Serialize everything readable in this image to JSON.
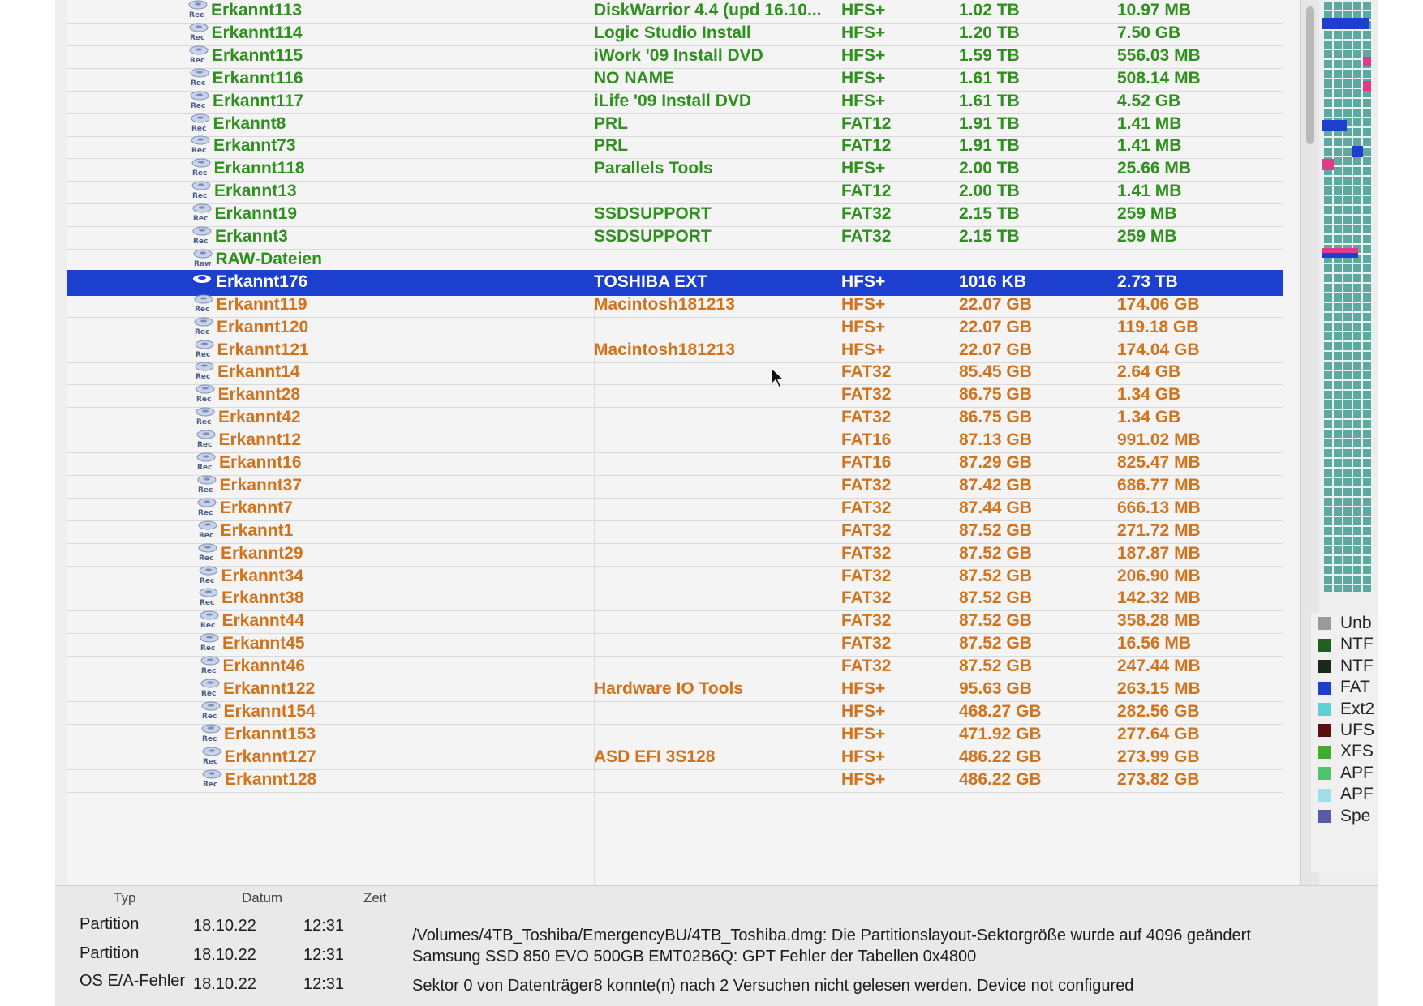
{
  "partitions": [
    {
      "name": "Erkannt113",
      "label": "DiskWarrior 4.4 (upd 16.10...",
      "fs": "HFS+",
      "start": "1.02 TB",
      "size": "10.97 MB",
      "group": "green",
      "icon": "rec-disk-icon"
    },
    {
      "name": "Erkannt114",
      "label": "Logic Studio Install",
      "fs": "HFS+",
      "start": "1.20 TB",
      "size": "7.50 GB",
      "group": "green",
      "icon": "rec-disk-icon"
    },
    {
      "name": "Erkannt115",
      "label": "iWork '09 Install DVD",
      "fs": "HFS+",
      "start": "1.59 TB",
      "size": "556.03 MB",
      "group": "green",
      "icon": "rec-disk-icon"
    },
    {
      "name": "Erkannt116",
      "label": "NO NAME",
      "fs": "HFS+",
      "start": "1.61 TB",
      "size": "508.14 MB",
      "group": "green",
      "icon": "rec-disk-icon"
    },
    {
      "name": "Erkannt117",
      "label": "iLife '09 Install DVD",
      "fs": "HFS+",
      "start": "1.61 TB",
      "size": "4.52 GB",
      "group": "green",
      "icon": "rec-disk-icon"
    },
    {
      "name": "Erkannt8",
      "label": "PRL",
      "fs": "FAT12",
      "start": "1.91 TB",
      "size": "1.41 MB",
      "group": "green",
      "icon": "rec-disk-icon"
    },
    {
      "name": "Erkannt73",
      "label": "PRL",
      "fs": "FAT12",
      "start": "1.91 TB",
      "size": "1.41 MB",
      "group": "green",
      "icon": "rec-disk-icon"
    },
    {
      "name": "Erkannt118",
      "label": "Parallels Tools",
      "fs": "HFS+",
      "start": "2.00 TB",
      "size": "25.66 MB",
      "group": "green",
      "icon": "rec-disk-icon"
    },
    {
      "name": "Erkannt13",
      "label": "",
      "fs": "FAT12",
      "start": "2.00 TB",
      "size": "1.41 MB",
      "group": "green",
      "icon": "rec-disk-icon"
    },
    {
      "name": "Erkannt19",
      "label": "SSDSUPPORT",
      "fs": "FAT32",
      "start": "2.15 TB",
      "size": "259 MB",
      "group": "green",
      "icon": "rec-disk-icon"
    },
    {
      "name": "Erkannt3",
      "label": "SSDSUPPORT",
      "fs": "FAT32",
      "start": "2.15 TB",
      "size": "259 MB",
      "group": "green",
      "icon": "rec-disk-icon"
    },
    {
      "name": "RAW-Dateien",
      "label": "",
      "fs": "",
      "start": "",
      "size": "",
      "group": "green",
      "icon": "raw-disk-icon"
    },
    {
      "name": "Erkannt176",
      "label": "TOSHIBA EXT",
      "fs": "HFS+",
      "start": "1016 KB",
      "size": "2.73 TB",
      "group": "selected",
      "icon": "disk-icon"
    },
    {
      "name": "Erkannt119",
      "label": "Macintosh181213",
      "fs": "HFS+",
      "start": "22.07 GB",
      "size": "174.06 GB",
      "group": "orange",
      "icon": "rec-disk-icon"
    },
    {
      "name": "Erkannt120",
      "label": "",
      "fs": "HFS+",
      "start": "22.07 GB",
      "size": "119.18 GB",
      "group": "orange",
      "icon": "rec-disk-icon"
    },
    {
      "name": "Erkannt121",
      "label": "Macintosh181213",
      "fs": "HFS+",
      "start": "22.07 GB",
      "size": "174.04 GB",
      "group": "orange",
      "icon": "rec-disk-icon"
    },
    {
      "name": "Erkannt14",
      "label": "",
      "fs": "FAT32",
      "start": "85.45 GB",
      "size": "2.64 GB",
      "group": "orange",
      "icon": "rec-disk-icon"
    },
    {
      "name": "Erkannt28",
      "label": "",
      "fs": "FAT32",
      "start": "86.75 GB",
      "size": "1.34 GB",
      "group": "orange",
      "icon": "rec-disk-icon"
    },
    {
      "name": "Erkannt42",
      "label": "",
      "fs": "FAT32",
      "start": "86.75 GB",
      "size": "1.34 GB",
      "group": "orange",
      "icon": "rec-disk-icon"
    },
    {
      "name": "Erkannt12",
      "label": "",
      "fs": "FAT16",
      "start": "87.13 GB",
      "size": "991.02 MB",
      "group": "orange",
      "icon": "rec-disk-icon"
    },
    {
      "name": "Erkannt16",
      "label": "",
      "fs": "FAT16",
      "start": "87.29 GB",
      "size": "825.47 MB",
      "group": "orange",
      "icon": "rec-disk-icon"
    },
    {
      "name": "Erkannt37",
      "label": "",
      "fs": "FAT32",
      "start": "87.42 GB",
      "size": "686.77 MB",
      "group": "orange",
      "icon": "rec-disk-icon"
    },
    {
      "name": "Erkannt7",
      "label": "",
      "fs": "FAT32",
      "start": "87.44 GB",
      "size": "666.13 MB",
      "group": "orange",
      "icon": "rec-disk-icon"
    },
    {
      "name": "Erkannt1",
      "label": "",
      "fs": "FAT32",
      "start": "87.52 GB",
      "size": "271.72 MB",
      "group": "orange",
      "icon": "rec-disk-icon"
    },
    {
      "name": "Erkannt29",
      "label": "",
      "fs": "FAT32",
      "start": "87.52 GB",
      "size": "187.87 MB",
      "group": "orange",
      "icon": "rec-disk-icon"
    },
    {
      "name": "Erkannt34",
      "label": "",
      "fs": "FAT32",
      "start": "87.52 GB",
      "size": "206.90 MB",
      "group": "orange",
      "icon": "rec-disk-icon"
    },
    {
      "name": "Erkannt38",
      "label": "",
      "fs": "FAT32",
      "start": "87.52 GB",
      "size": "142.32 MB",
      "group": "orange",
      "icon": "rec-disk-icon"
    },
    {
      "name": "Erkannt44",
      "label": "",
      "fs": "FAT32",
      "start": "87.52 GB",
      "size": "358.28 MB",
      "group": "orange",
      "icon": "rec-disk-icon"
    },
    {
      "name": "Erkannt45",
      "label": "",
      "fs": "FAT32",
      "start": "87.52 GB",
      "size": "16.56 MB",
      "group": "orange",
      "icon": "rec-disk-icon"
    },
    {
      "name": "Erkannt46",
      "label": "",
      "fs": "FAT32",
      "start": "87.52 GB",
      "size": "247.44 MB",
      "group": "orange",
      "icon": "rec-disk-icon"
    },
    {
      "name": "Erkannt122",
      "label": "Hardware IO Tools",
      "fs": "HFS+",
      "start": "95.63 GB",
      "size": "263.15 MB",
      "group": "orange",
      "icon": "rec-disk-icon"
    },
    {
      "name": "Erkannt154",
      "label": "",
      "fs": "HFS+",
      "start": "468.27 GB",
      "size": "282.56 GB",
      "group": "orange",
      "icon": "rec-disk-icon"
    },
    {
      "name": "Erkannt153",
      "label": "",
      "fs": "HFS+",
      "start": "471.92 GB",
      "size": "277.64 GB",
      "group": "orange",
      "icon": "rec-disk-icon"
    },
    {
      "name": "Erkannt127",
      "label": "ASD EFI 3S128",
      "fs": "HFS+",
      "start": "486.22 GB",
      "size": "273.99 GB",
      "group": "orange",
      "icon": "rec-disk-icon"
    },
    {
      "name": "Erkannt128",
      "label": "",
      "fs": "HFS+",
      "start": "486.22 GB",
      "size": "273.82 GB",
      "group": "orange",
      "icon": "rec-disk-icon"
    }
  ],
  "colors": {
    "green_text": "#2f8f1f",
    "orange_text": "#d2721d",
    "selection": "#1c3fcf",
    "map_fill": "#5fa8a0"
  },
  "legend": [
    {
      "label": "Unb",
      "color": "#9a9a9a"
    },
    {
      "label": "NTF",
      "color": "#1f5f1f"
    },
    {
      "label": "NTF",
      "color": "#1a2a1a"
    },
    {
      "label": "FAT",
      "color": "#1c3fcf"
    },
    {
      "label": "Ext2",
      "color": "#5fd0d0"
    },
    {
      "label": "UFS",
      "color": "#5a1010"
    },
    {
      "label": "XFS",
      "color": "#3fae2f"
    },
    {
      "label": "APF",
      "color": "#4fc46f"
    },
    {
      "label": "APF",
      "color": "#9fe0e8"
    },
    {
      "label": "Spe",
      "color": "#5a5aa8"
    }
  ],
  "log": {
    "headers": {
      "type": "Typ",
      "date": "Datum",
      "time": "Zeit"
    },
    "entries": [
      {
        "type": "Partition",
        "date": "18.10.22",
        "time": "12:31",
        "message": "/Volumes/4TB_Toshiba/EmergencyBU/4TB_Toshiba.dmg: Die Partitionslayout-Sektorgröße wurde auf 4096 geändert"
      },
      {
        "type": "Partition",
        "date": "18.10.22",
        "time": "12:31",
        "message": "Samsung SSD 850 EVO 500GB EMT02B6Q: GPT Fehler der Tabellen 0x4800"
      },
      {
        "type": "OS E/A-Fehler",
        "date": "18.10.22",
        "time": "12:31",
        "message": "Sektor 0 von Datenträger8 konnte(n) nach 2 Versuchen nicht gelesen werden. Device not configured"
      }
    ]
  }
}
